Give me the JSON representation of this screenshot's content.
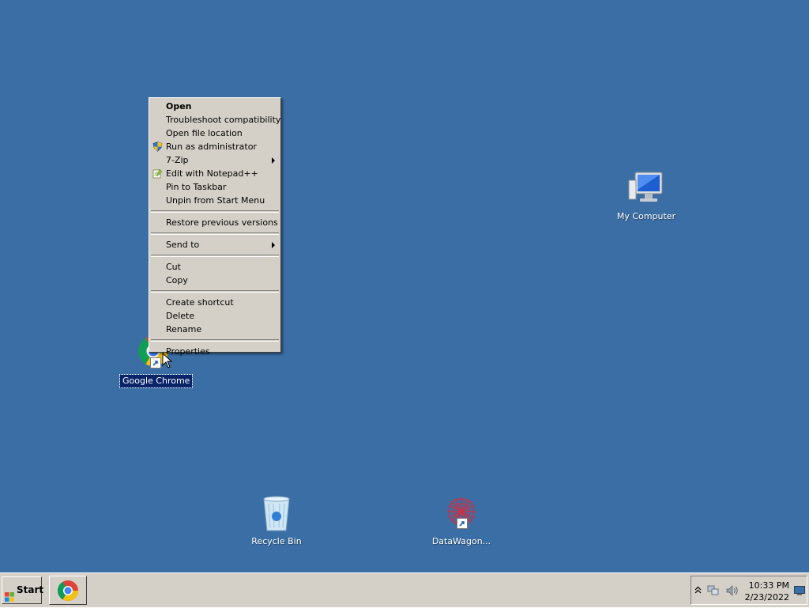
{
  "desktop": {
    "background_color": "#3b6ea5",
    "icons": [
      {
        "label": "Google Chrome",
        "icon": "chrome-shortcut-icon",
        "selected": true
      },
      {
        "label": "My Computer",
        "icon": "my-computer-icon"
      },
      {
        "label": "Recycle Bin",
        "icon": "recycle-bin-icon"
      },
      {
        "label": "DataWagon...",
        "icon": "datawagon-shortcut-icon"
      }
    ]
  },
  "context_menu": {
    "items": [
      {
        "label": "Open",
        "bold": true
      },
      {
        "label": "Troubleshoot compatibility"
      },
      {
        "label": "Open file location"
      },
      {
        "label": "Run as administrator",
        "icon": "uac-shield-icon"
      },
      {
        "label": "7-Zip",
        "submenu": true
      },
      {
        "label": "Edit with Notepad++",
        "icon": "notepad-plus-plus-icon"
      },
      {
        "label": "Pin to Taskbar"
      },
      {
        "label": "Unpin from Start Menu"
      },
      {
        "label": "Restore previous versions"
      },
      {
        "label": "Send to",
        "submenu": true
      },
      {
        "label": "Cut"
      },
      {
        "label": "Copy"
      },
      {
        "label": "Create shortcut"
      },
      {
        "label": "Delete"
      },
      {
        "label": "Rename"
      },
      {
        "label": "Properties"
      }
    ]
  },
  "taskbar": {
    "start_label": "Start",
    "pinned": [
      {
        "name": "Google Chrome",
        "icon": "chrome-icon"
      }
    ],
    "tray": {
      "icons": [
        "show-hidden-icons-chevron",
        "network-icon",
        "volume-icon",
        "show-desktop-icon"
      ],
      "time": "10:33 PM",
      "date": "2/23/2022"
    }
  }
}
